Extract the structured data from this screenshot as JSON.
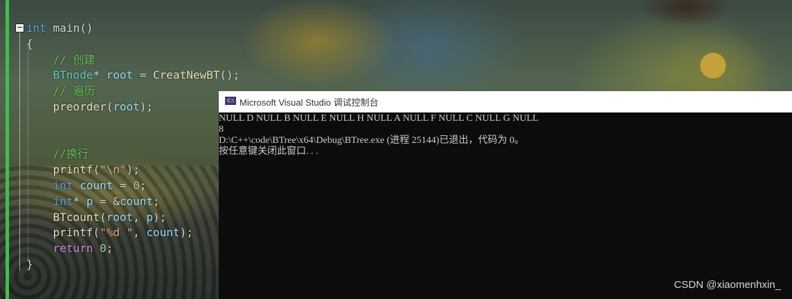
{
  "editor": {
    "collapse_glyph": "−",
    "lines": [
      {
        "segments": [
          {
            "cls": "kw",
            "t": "int"
          },
          {
            "cls": "pl",
            "t": " main()"
          }
        ]
      },
      {
        "segments": [
          {
            "cls": "pl",
            "t": "{"
          }
        ]
      },
      {
        "segments": [
          {
            "cls": "cm",
            "t": "    // 创建"
          }
        ]
      },
      {
        "segments": [
          {
            "cls": "ty",
            "t": "    BTnode"
          },
          {
            "cls": "pl",
            "t": "* "
          },
          {
            "cls": "var",
            "t": "root"
          },
          {
            "cls": "pl",
            "t": " = "
          },
          {
            "cls": "fn",
            "t": "CreatNewBT"
          },
          {
            "cls": "pl",
            "t": "();"
          }
        ]
      },
      {
        "segments": [
          {
            "cls": "cm",
            "t": "    // 遍历"
          }
        ]
      },
      {
        "segments": [
          {
            "cls": "fn",
            "t": "    preorder"
          },
          {
            "cls": "pl",
            "t": "("
          },
          {
            "cls": "var",
            "t": "root"
          },
          {
            "cls": "pl",
            "t": ");"
          }
        ]
      },
      {
        "segments": []
      },
      {
        "segments": []
      },
      {
        "segments": [
          {
            "cls": "cm",
            "t": "    //换行"
          }
        ]
      },
      {
        "segments": [
          {
            "cls": "fn",
            "t": "    printf"
          },
          {
            "cls": "pl",
            "t": "("
          },
          {
            "cls": "str",
            "t": "\"\\n\""
          },
          {
            "cls": "pl",
            "t": ");"
          }
        ]
      },
      {
        "segments": [
          {
            "cls": "kw",
            "t": "    int"
          },
          {
            "cls": "pl",
            "t": " "
          },
          {
            "cls": "var",
            "t": "count"
          },
          {
            "cls": "pl",
            "t": " = "
          },
          {
            "cls": "num",
            "t": "0"
          },
          {
            "cls": "pl",
            "t": ";"
          }
        ]
      },
      {
        "segments": [
          {
            "cls": "kw",
            "t": "    int"
          },
          {
            "cls": "pl",
            "t": "* "
          },
          {
            "cls": "var",
            "t": "p"
          },
          {
            "cls": "pl",
            "t": " = &"
          },
          {
            "cls": "var",
            "t": "count"
          },
          {
            "cls": "pl",
            "t": ";"
          }
        ]
      },
      {
        "segments": [
          {
            "cls": "fn",
            "t": "    BTcount"
          },
          {
            "cls": "pl",
            "t": "("
          },
          {
            "cls": "var",
            "t": "root"
          },
          {
            "cls": "pl",
            "t": ", "
          },
          {
            "cls": "var",
            "t": "p"
          },
          {
            "cls": "pl",
            "t": ");"
          }
        ]
      },
      {
        "segments": [
          {
            "cls": "fn",
            "t": "    printf"
          },
          {
            "cls": "pl",
            "t": "("
          },
          {
            "cls": "str",
            "t": "\"%d \""
          },
          {
            "cls": "pl",
            "t": ", "
          },
          {
            "cls": "var",
            "t": "count"
          },
          {
            "cls": "pl",
            "t": ");"
          }
        ]
      },
      {
        "segments": [
          {
            "cls": "ctl",
            "t": "    return"
          },
          {
            "cls": "pl",
            "t": " "
          },
          {
            "cls": "num",
            "t": "0"
          },
          {
            "cls": "pl",
            "t": ";"
          }
        ]
      },
      {
        "segments": [
          {
            "cls": "pl",
            "t": "}"
          }
        ]
      }
    ]
  },
  "console": {
    "icon_label": "C:\\",
    "title": "Microsoft Visual Studio 调试控制台",
    "lines": [
      "NULL D NULL B NULL E NULL H NULL A NULL F NULL C NULL G NULL",
      "8",
      "D:\\C++\\code\\BTree\\x64\\Debug\\BTree.exe (进程 25144)已退出，代码为 0。",
      "按任意键关闭此窗口. . ."
    ]
  },
  "watermark": "CSDN @xiaomenhxin_",
  "colors": {
    "editor_gutter_bar": "#3fbf4f",
    "console_background": "#0c0c0c",
    "console_text": "#cccccc",
    "keyword": "#5c9fe8",
    "comment": "#6bbf5a"
  }
}
